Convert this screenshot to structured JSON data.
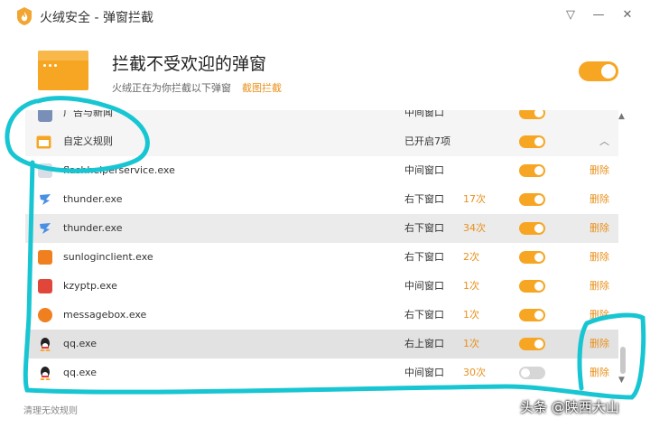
{
  "window": {
    "title": "火绒安全 - 弹窗拦截",
    "buttons": {
      "menu": "▽",
      "minimize": "—",
      "close": "✕"
    }
  },
  "header": {
    "title": "拦截不受欢迎的弹窗",
    "subtitle": "火绒正在为你拦截以下弹窗",
    "link": "截图拦截",
    "master_toggle_on": true
  },
  "group_partial": {
    "name": "广告与新闻",
    "position": "中间窗口"
  },
  "group": {
    "name": "自定义规则",
    "status": "已开启7项",
    "collapse": "︿"
  },
  "rows": [
    {
      "icon": "flash-helper-icon",
      "name": "flashhelperservice.exe",
      "position": "中间窗口",
      "count": "",
      "enabled": true,
      "delete": "删除"
    },
    {
      "icon": "thunder-icon",
      "name": "thunder.exe",
      "position": "右下窗口",
      "count": "17次",
      "enabled": true,
      "delete": "删除"
    },
    {
      "icon": "thunder-icon",
      "name": "thunder.exe",
      "position": "右下窗口",
      "count": "34次",
      "enabled": true,
      "delete": "删除"
    },
    {
      "icon": "sunlogin-icon",
      "name": "sunloginclient.exe",
      "position": "右下窗口",
      "count": "2次",
      "enabled": true,
      "delete": "删除"
    },
    {
      "icon": "kzyptp-icon",
      "name": "kzyptp.exe",
      "position": "中间窗口",
      "count": "1次",
      "enabled": true,
      "delete": "删除"
    },
    {
      "icon": "messagebox-icon",
      "name": "messagebox.exe",
      "position": "右下窗口",
      "count": "1次",
      "enabled": true,
      "delete": "删除"
    },
    {
      "icon": "qq-icon",
      "name": "qq.exe",
      "position": "右上窗口",
      "count": "1次",
      "enabled": true,
      "delete": "删除"
    },
    {
      "icon": "qq-icon",
      "name": "qq.exe",
      "position": "中间窗口",
      "count": "30次",
      "enabled": false,
      "delete": "删除"
    }
  ],
  "scrollbar": {
    "up": "▲",
    "down": "▼"
  },
  "footer": {
    "link": "清理无效规则"
  },
  "watermark": "头条 @陕西大山",
  "colors": {
    "accent": "#f6a623",
    "link": "#e8901b",
    "annotation": "#17c6d2"
  }
}
